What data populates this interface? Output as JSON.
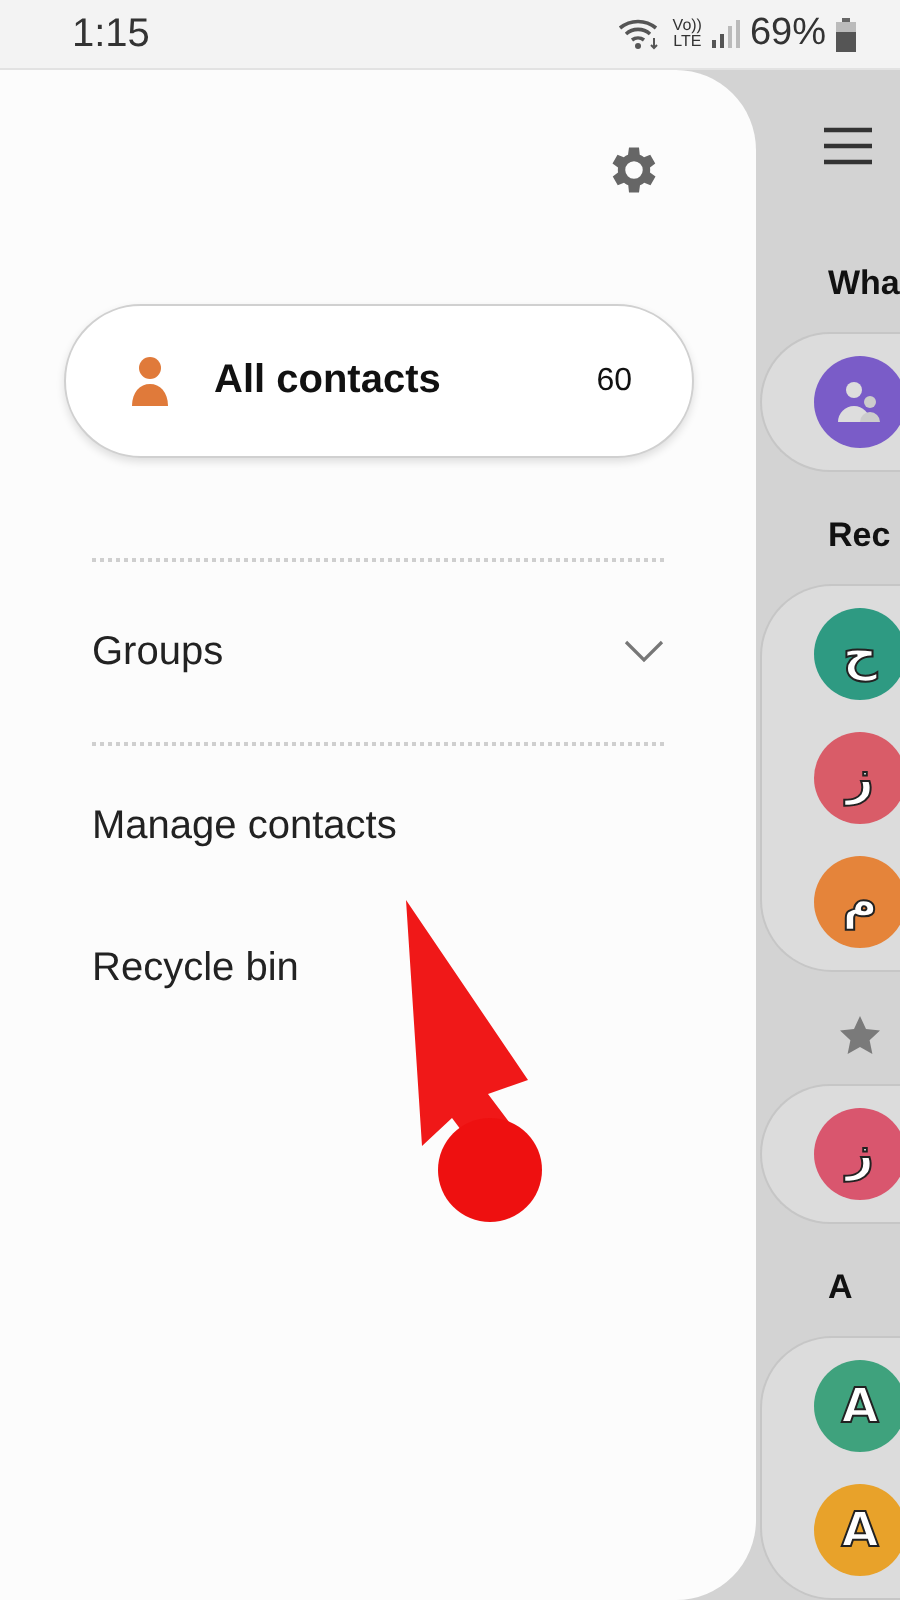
{
  "status_bar": {
    "time": "1:15",
    "volte_top": "Vo))",
    "volte_bottom": "LTE",
    "battery": "69%"
  },
  "drawer": {
    "all_contacts": {
      "label": "All contacts",
      "count": "60",
      "selected": true
    },
    "groups": {
      "label": "Groups",
      "expanded": false
    },
    "items": [
      {
        "label": "Manage contacts"
      },
      {
        "label": "Recycle bin"
      }
    ]
  },
  "contacts": {
    "sections": [
      {
        "kind": "text",
        "title": "Wha",
        "avatars": [
          {
            "kind": "group",
            "color": "#7a5cc8"
          }
        ]
      },
      {
        "kind": "text",
        "title": "Rec",
        "avatars": [
          {
            "kind": "letter",
            "letter": "ح",
            "color": "#2e9a82"
          },
          {
            "kind": "letter",
            "letter": "ز",
            "color": "#d95c68"
          },
          {
            "kind": "letter",
            "letter": "م",
            "color": "#e5843a"
          }
        ]
      },
      {
        "kind": "star",
        "avatars": [
          {
            "kind": "letter",
            "letter": "ز",
            "color": "#d9566e"
          }
        ]
      },
      {
        "kind": "text",
        "title": "A",
        "avatars": [
          {
            "kind": "letter",
            "letter": "A",
            "color": "#3fa27d"
          },
          {
            "kind": "letter",
            "letter": "A",
            "color": "#e8a22a"
          }
        ]
      }
    ]
  }
}
